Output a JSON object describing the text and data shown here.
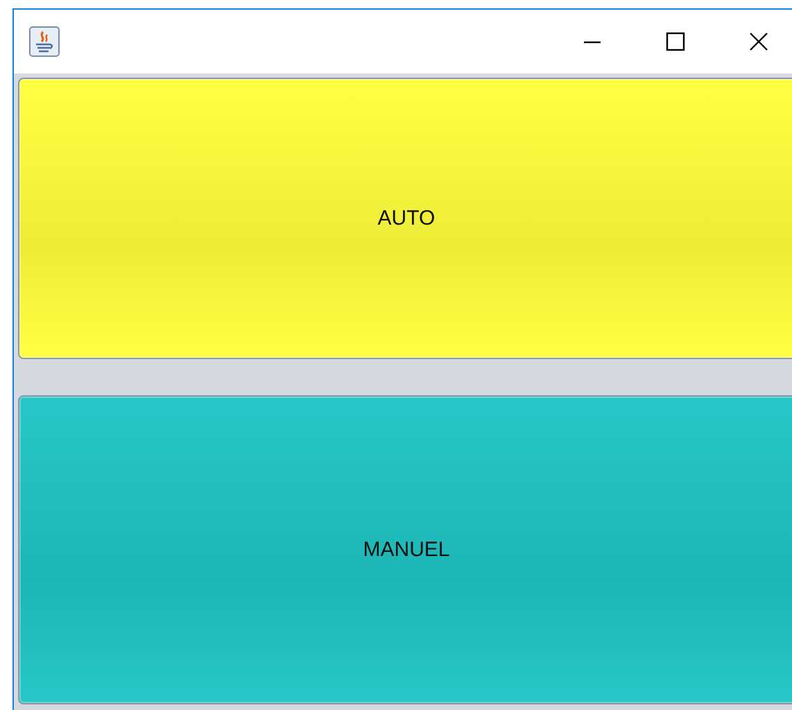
{
  "buttons": [
    {
      "label": "AUTO",
      "color": "#ffff3c"
    },
    {
      "label": "MANUEL",
      "color": "#1fc4c4"
    }
  ]
}
